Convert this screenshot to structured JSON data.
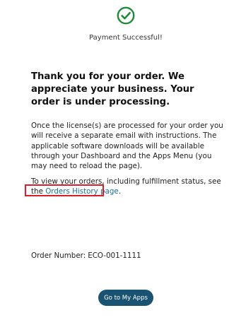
{
  "status": {
    "icon": "check-circle-icon",
    "icon_color": "#1f8a3a",
    "message": "Payment Successful!"
  },
  "confirmation": {
    "heading": "Thank you for your order. We appreciate your business. Your order is under processing.",
    "license_info": "Once the license(s) are processed for your order you will receive a separate email with instructions. The applicable software downloads will be available through your Dashboard and the Apps Menu (you may need to reload the page).",
    "orders_prefix": "To view your orders, including fulfillment status, see the",
    "orders_link_label": "Orders History page",
    "orders_suffix": "."
  },
  "order": {
    "number_label": "Order Number:",
    "number_value": "ECO-001-1111"
  },
  "actions": {
    "go_to_apps_label": "Go to My Apps",
    "button_color": "#1a5272",
    "link_color": "#1e6f9f",
    "highlight_color": "#d81e2c"
  }
}
